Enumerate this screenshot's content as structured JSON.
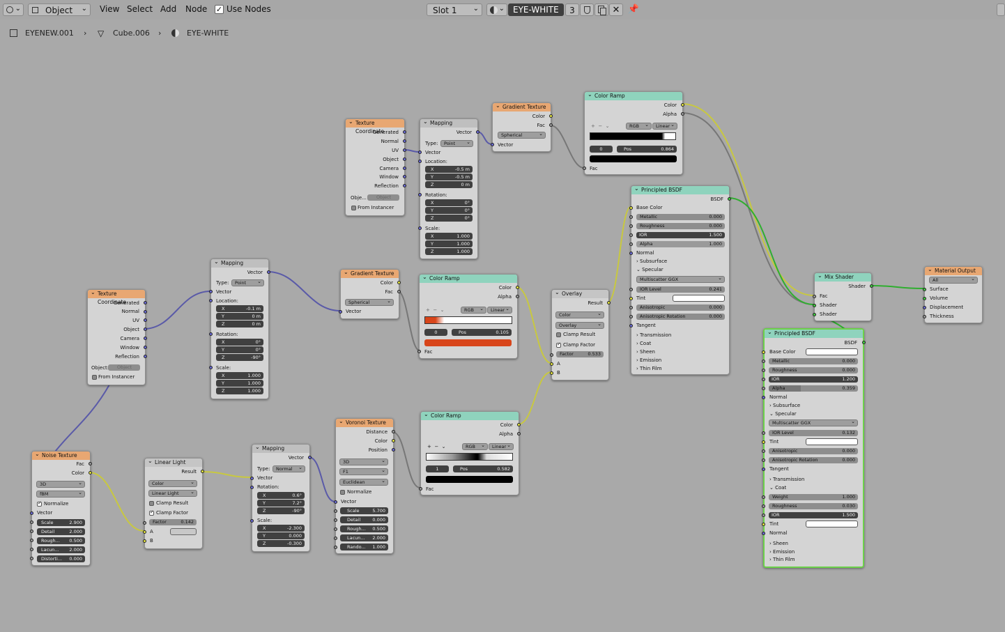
{
  "header": {
    "editor_type_icon": "node-editor-icon",
    "mode": "Object",
    "menus": [
      "View",
      "Select",
      "Add",
      "Node"
    ],
    "use_nodes_label": "Use Nodes",
    "slot": "Slot 1",
    "material_name": "EYE-WHITE",
    "user_count": "3"
  },
  "breadcrumb": {
    "object": "EYENEW.001",
    "mesh": "Cube.006",
    "material": "EYE-WHITE"
  },
  "nodes": {
    "tc1": {
      "title": "Texture Coordinate",
      "outputs": [
        "Generated",
        "Normal",
        "UV",
        "Object",
        "Camera",
        "Window",
        "Reflection"
      ],
      "object_label": "Obje...",
      "object_placeholder": "Object",
      "from_instancer": "From Instancer"
    },
    "map1": {
      "title": "Mapping",
      "out": "Vector",
      "type_label": "Type:",
      "type": "Point",
      "vector": "Vector",
      "location": "Location:",
      "loc": [
        "-0.5 m",
        "-0.5 m",
        "0 m"
      ],
      "rotation": "Rotation:",
      "rot": [
        "0°",
        "0°",
        "0°"
      ],
      "scale": "Scale:",
      "scl": [
        "1.000",
        "1.000",
        "1.000"
      ]
    },
    "gt1": {
      "title": "Gradient Texture",
      "color": "Color",
      "fac": "Fac",
      "kind": "Spherical",
      "vector": "Vector"
    },
    "cr1": {
      "title": "Color Ramp",
      "color": "Color",
      "alpha": "Alpha",
      "mode": "RGB",
      "interp": "Linear",
      "idx": "0",
      "pos_label": "Pos",
      "pos": "0.864",
      "fac": "Fac"
    },
    "pb1": {
      "title": "Principled BSDF",
      "out": "BSDF",
      "base_color": "Base Color",
      "metallic": "Metallic",
      "metallic_v": "0.000",
      "roughness": "Roughness",
      "roughness_v": "0.000",
      "ior": "IOR",
      "ior_v": "1.500",
      "alpha": "Alpha",
      "alpha_v": "1.000",
      "normal": "Normal",
      "subsurface": "Subsurface",
      "specular": "Specular",
      "dist": "Multiscatter GGX",
      "ior_level": "IOR Level",
      "ior_level_v": "0.241",
      "tint": "Tint",
      "aniso": "Anisotropic",
      "aniso_v": "0.000",
      "aniso_rot": "Anisotropic Rotation",
      "aniso_rot_v": "0.000",
      "tangent": "Tangent",
      "transmission": "Transmission",
      "coat": "Coat",
      "sheen": "Sheen",
      "emission": "Emission",
      "thin_film": "Thin Film"
    },
    "tc2": {
      "title": "Texture Coordinate",
      "outputs": [
        "Generated",
        "Normal",
        "UV",
        "Object",
        "Camera",
        "Window",
        "Reflection"
      ],
      "object_label": "Object:",
      "object_placeholder": "Object",
      "from_instancer": "From Instancer"
    },
    "map2": {
      "title": "Mapping",
      "out": "Vector",
      "type_label": "Type:",
      "type": "Point",
      "vector": "Vector",
      "location": "Location:",
      "loc": [
        "-0.1 m",
        "0 m",
        "0 m"
      ],
      "rotation": "Rotation:",
      "rot": [
        "0°",
        "0°",
        "-90°"
      ],
      "scale": "Scale:",
      "scl": [
        "1.000",
        "1.000",
        "1.000"
      ]
    },
    "gt2": {
      "title": "Gradient Texture",
      "color": "Color",
      "fac": "Fac",
      "kind": "Spherical",
      "vector": "Vector"
    },
    "cr2": {
      "title": "Color Ramp",
      "color": "Color",
      "alpha": "Alpha",
      "mode": "RGB",
      "interp": "Linear",
      "idx": "0",
      "pos_label": "Pos",
      "pos": "0.105",
      "fac": "Fac"
    },
    "ov": {
      "title": "Overlay",
      "result": "Result",
      "type": "Color",
      "blend": "Overlay",
      "clamp_result": "Clamp Result",
      "clamp_factor": "Clamp Factor",
      "factor": "Factor",
      "factor_v": "0.533",
      "a": "A",
      "b": "B"
    },
    "mix": {
      "title": "Mix Shader",
      "out": "Shader",
      "fac": "Fac",
      "s1": "Shader",
      "s2": "Shader"
    },
    "mo": {
      "title": "Material Output",
      "target": "All",
      "surface": "Surface",
      "volume": "Volume",
      "displacement": "Displacement",
      "thickness": "Thickness"
    },
    "pb2": {
      "title": "Principled BSDF",
      "out": "BSDF",
      "base_color": "Base Color",
      "metallic": "Metallic",
      "metallic_v": "0.000",
      "roughness": "Roughness",
      "roughness_v": "0.000",
      "ior": "IOR",
      "ior_v": "1.200",
      "alpha": "Alpha",
      "alpha_v": "0.359",
      "normal": "Normal",
      "subsurface": "Subsurface",
      "specular": "Specular",
      "dist": "Multiscatter GGX",
      "ior_level": "IOR Level",
      "ior_level_v": "0.132",
      "tint": "Tint",
      "aniso": "Anisotropic",
      "aniso_v": "0.000",
      "aniso_rot": "Anisotropic Rotation",
      "aniso_rot_v": "0.000",
      "tangent": "Tangent",
      "transmission": "Transmission",
      "coat": "Coat",
      "weight": "Weight",
      "weight_v": "1.000",
      "c_rough": "Roughness",
      "c_rough_v": "0.030",
      "c_ior": "IOR",
      "c_ior_v": "1.500",
      "c_tint": "Tint",
      "c_normal": "Normal",
      "sheen": "Sheen",
      "emission": "Emission",
      "thin_film": "Thin Film"
    },
    "noise": {
      "title": "Noise Texture",
      "fac": "Fac",
      "color": "Color",
      "dim": "3D",
      "kind": "fBM",
      "normalize": "Normalize",
      "vector": "Vector",
      "scale": "Scale",
      "scale_v": "2.900",
      "detail": "Detail",
      "detail_v": "2.000",
      "rough": "Rough...",
      "rough_v": "0.500",
      "lacun": "Lacun...",
      "lacun_v": "2.000",
      "distort": "Distorti...",
      "distort_v": "0.000"
    },
    "ll": {
      "title": "Linear Light",
      "result": "Result",
      "type": "Color",
      "blend": "Linear Light",
      "clamp_result": "Clamp Result",
      "clamp_factor": "Clamp Factor",
      "factor": "Factor",
      "factor_v": "0.142",
      "a": "A",
      "b": "B"
    },
    "map3": {
      "title": "Mapping",
      "out": "Vector",
      "type_label": "Type:",
      "type": "Normal",
      "vector": "Vector",
      "rotation": "Rotation:",
      "rot": [
        "0.6°",
        "7.2°",
        "-90°"
      ],
      "scale": "Scale:",
      "scl": [
        "-2.300",
        "0.000",
        "-0.300"
      ]
    },
    "vor": {
      "title": "Voronoi Texture",
      "distance": "Distance",
      "color": "Color",
      "position": "Position",
      "dim": "3D",
      "feature": "F1",
      "metric": "Euclidean",
      "normalize": "Normalize",
      "vector": "Vector",
      "scale": "Scale",
      "scale_v": "5.700",
      "detail": "Detail",
      "detail_v": "0.000",
      "rough": "Rough...",
      "rough_v": "0.500",
      "lacun": "Lacun...",
      "lacun_v": "2.000",
      "rando": "Rando...",
      "rando_v": "1.000"
    },
    "cr3": {
      "title": "Color Ramp",
      "color": "Color",
      "alpha": "Alpha",
      "mode": "RGB",
      "interp": "Linear",
      "idx": "1",
      "pos_label": "Pos",
      "pos": "0.582",
      "fac": "Fac"
    }
  },
  "axes": [
    "X",
    "Y",
    "Z"
  ],
  "colors": {
    "socket_color": "#e5e540",
    "socket_float": "#9a9a9a",
    "socket_vector": "#6b6bd6",
    "socket_shader": "#3fcf3f",
    "selected_border": "#6cd14a",
    "ramp_orange": "#d8451a"
  }
}
